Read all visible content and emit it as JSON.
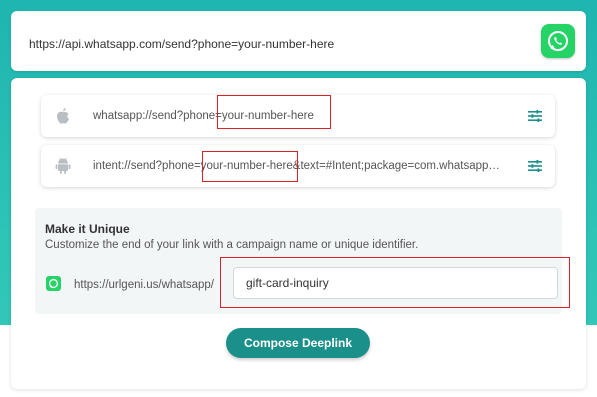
{
  "url_bar": {
    "url": "https://api.whatsapp.com/send?phone=your-number-here",
    "logo_icon": "whatsapp-logo-icon"
  },
  "links": [
    {
      "platform": "ios",
      "icon": "apple-icon",
      "text": "whatsapp://send?phone=your-number-here",
      "action_icon": "sliders-icon"
    },
    {
      "platform": "android",
      "icon": "android-icon",
      "text": "intent://send?phone=your-number-here&text=#Intent;package=com.whatsapp…",
      "action_icon": "sliders-icon"
    }
  ],
  "unique": {
    "title": "Make it Unique",
    "subtitle": "Customize the end of your link with a campaign name or unique identifier.",
    "prefix": "https://urlgeni.us/whatsapp/",
    "slug_value": "gift-card-inquiry",
    "icon": "whatsapp-small-icon"
  },
  "compose_button": {
    "label": "Compose Deeplink"
  },
  "colors": {
    "accent": "#1b8f8a",
    "background": "#2ec4b6",
    "whatsapp_green": "#25d366",
    "highlight": "#d9232a"
  }
}
